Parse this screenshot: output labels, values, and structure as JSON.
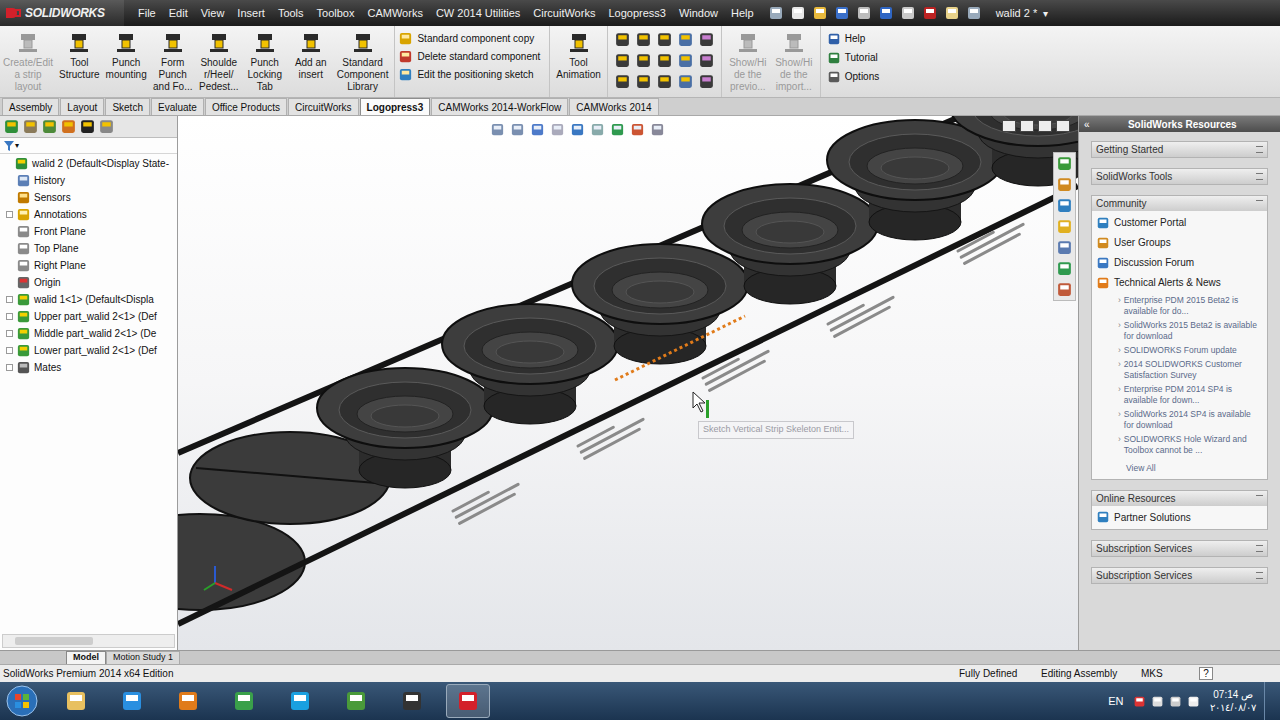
{
  "window": {
    "logo": "SOLIDWORKS",
    "document": "walid 2 *",
    "document_menu": "▾"
  },
  "menu": [
    "File",
    "Edit",
    "View",
    "Insert",
    "Tools",
    "Toolbox",
    "CAMWorks",
    "CW 2014 Utilities",
    "CircuitWorks",
    "Logopress3",
    "Window",
    "Help"
  ],
  "ribbon": {
    "large_buttons": [
      {
        "lines": [
          "Create/Edit",
          "a strip",
          "layout"
        ],
        "disabled": true
      },
      {
        "lines": [
          "Tool",
          "Structure"
        ],
        "disabled": false
      },
      {
        "lines": [
          "Punch",
          "mounting"
        ],
        "disabled": false
      },
      {
        "lines": [
          "Form",
          "Punch",
          "and Fo..."
        ],
        "disabled": false
      },
      {
        "lines": [
          "Shoulde",
          "r/Heel/",
          "Pedest..."
        ],
        "disabled": false
      },
      {
        "lines": [
          "Punch",
          "Locking",
          "Tab"
        ],
        "disabled": false
      },
      {
        "lines": [
          "Add an",
          "insert"
        ],
        "disabled": false
      },
      {
        "lines": [
          "Standard",
          "Component",
          "Library"
        ],
        "disabled": false
      }
    ],
    "small_buttons": [
      "Standard component copy",
      "Delete standard component",
      "Edit the positioning sketch"
    ],
    "animation_button": {
      "lines": [
        "Tool",
        "Animation"
      ],
      "disabled": false
    },
    "show_buttons": [
      {
        "lines": [
          "Show/Hi",
          "de the",
          "previo..."
        ],
        "disabled": true
      },
      {
        "lines": [
          "Show/Hi",
          "de the",
          "import..."
        ],
        "disabled": true
      }
    ],
    "help_buttons": [
      "Help",
      "Tutorial",
      "Options"
    ]
  },
  "tabs": [
    {
      "label": "Assembly",
      "selected": false
    },
    {
      "label": "Layout",
      "selected": false
    },
    {
      "label": "Sketch",
      "selected": false
    },
    {
      "label": "Evaluate",
      "selected": false
    },
    {
      "label": "Office Products",
      "selected": false
    },
    {
      "label": "CircuitWorks",
      "selected": false
    },
    {
      "label": "Logopress3",
      "selected": true
    },
    {
      "label": "CAMWorks 2014-WorkFlow",
      "selected": false
    },
    {
      "label": "CAMWorks 2014",
      "selected": false
    }
  ],
  "feature_tree": {
    "filter": "▾",
    "items": [
      {
        "label": "walid 2  (Default<Display State-",
        "kind": "assembly",
        "expandable": false,
        "root": true
      },
      {
        "label": "History",
        "kind": "history",
        "expandable": false,
        "root": false
      },
      {
        "label": "Sensors",
        "kind": "sensors",
        "expandable": false,
        "root": false
      },
      {
        "label": "Annotations",
        "kind": "annotations",
        "expandable": true,
        "root": false
      },
      {
        "label": "Front Plane",
        "kind": "plane",
        "expandable": false,
        "root": false
      },
      {
        "label": "Top Plane",
        "kind": "plane",
        "expandable": false,
        "root": false
      },
      {
        "label": "Right Plane",
        "kind": "plane",
        "expandable": false,
        "root": false
      },
      {
        "label": "Origin",
        "kind": "origin",
        "expandable": false,
        "root": false
      },
      {
        "label": "walid 1<1> (Default<Displa",
        "kind": "part",
        "expandable": true,
        "root": false
      },
      {
        "label": "Upper part_walid 2<1> (Def",
        "kind": "part",
        "expandable": true,
        "root": false
      },
      {
        "label": "Middle part_walid 2<1> (De",
        "kind": "part",
        "expandable": true,
        "root": false
      },
      {
        "label": "Lower part_walid 2<1> (Def",
        "kind": "part",
        "expandable": true,
        "root": false
      },
      {
        "label": "Mates",
        "kind": "mates",
        "expandable": true,
        "root": false
      }
    ]
  },
  "viewport": {
    "tooltip": "Sketch Vertical Strip Skeleton Entit..."
  },
  "task_pane": {
    "title": "SolidWorks Resources",
    "collapse": "«",
    "sections": [
      {
        "title": "Getting Started",
        "expanded": false,
        "links": [],
        "news": [],
        "more": ""
      },
      {
        "title": "SolidWorks Tools",
        "expanded": false,
        "links": [],
        "news": [],
        "more": ""
      },
      {
        "title": "Community",
        "expanded": true,
        "links": [
          "Customer Portal",
          "User Groups",
          "Discussion Forum",
          "Technical Alerts & News"
        ],
        "news": [
          "Enterprise PDM 2015 Beta2 is available for do...",
          "SolidWorks 2015 Beta2 is available for download",
          "SOLIDWORKS Forum update",
          "2014 SOLIDWORKS Customer Satisfaction Survey",
          "Enterprise PDM 2014 SP4 is available for down...",
          "SolidWorks 2014 SP4 is available for download",
          "SOLIDWORKS Hole Wizard and Toolbox cannot be ..."
        ],
        "more": "View All"
      },
      {
        "title": "Online Resources",
        "expanded": true,
        "links": [
          "Partner Solutions"
        ],
        "news": [],
        "more": ""
      },
      {
        "title": "Subscription Services",
        "expanded": false,
        "links": [],
        "news": [],
        "more": ""
      },
      {
        "title": "Subscription Services",
        "expanded": false,
        "links": [],
        "news": [],
        "more": ""
      }
    ]
  },
  "bottom_tabs": [
    {
      "label": "Model",
      "selected": true
    },
    {
      "label": "Motion Study 1",
      "selected": false
    }
  ],
  "status_bar": {
    "edition": "SolidWorks Premium 2014 x64 Edition",
    "state": "Fully Defined",
    "mode": "Editing Assembly",
    "units": "MKS",
    "help": "?"
  },
  "taskbar": {
    "language": "EN",
    "time": "07:14 ص",
    "date": "٢٠١٤/٠٨/٠٧"
  }
}
